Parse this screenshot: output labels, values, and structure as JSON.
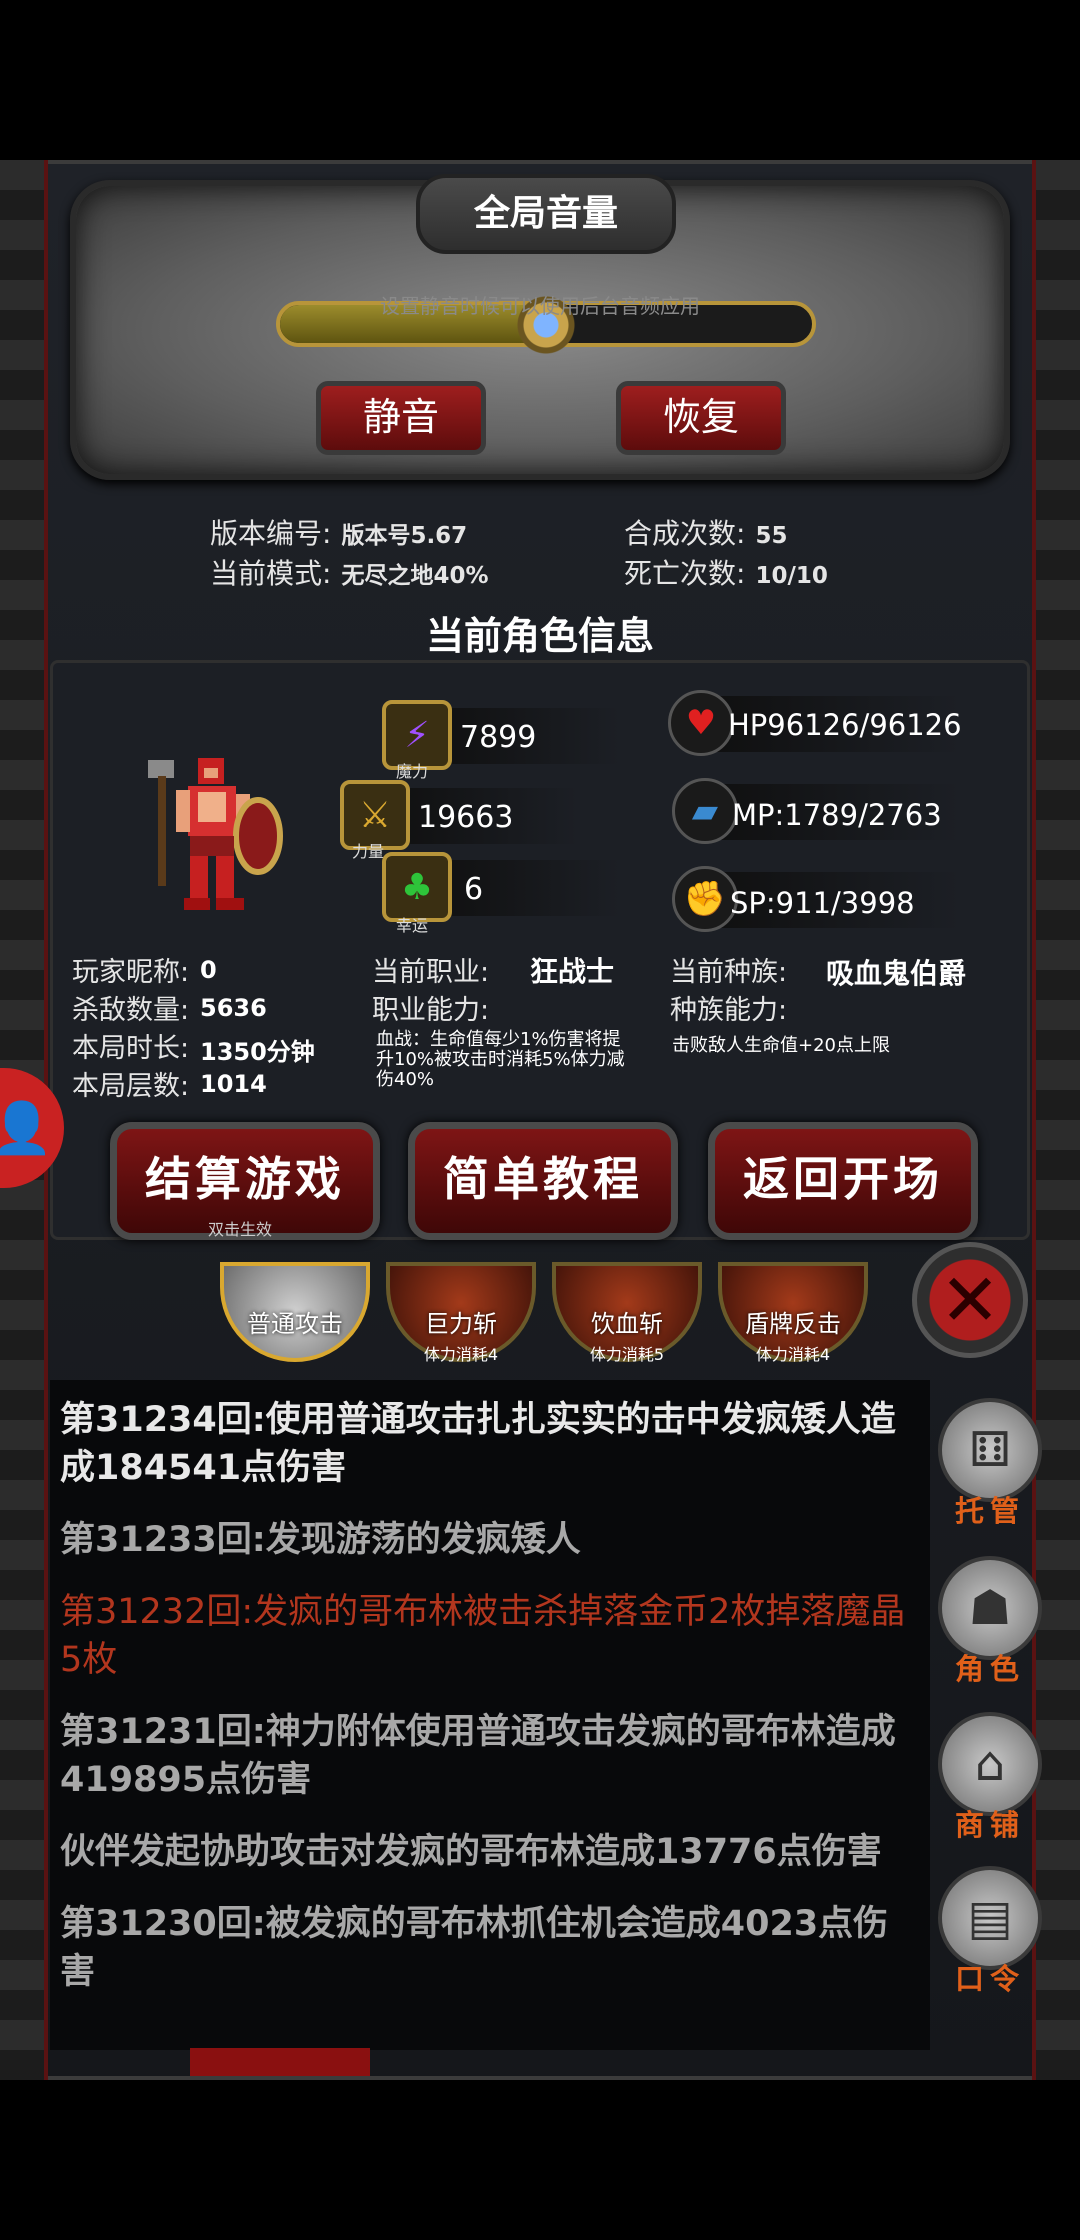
{
  "volume": {
    "title": "全局音量",
    "level": 0.5,
    "mute_label": "静音",
    "restore_label": "恢复",
    "hint": "设置静音时候可以使用后台音频应用"
  },
  "game_info": {
    "version_label": "版本编号:",
    "version_value": "版本号5.67",
    "mode_label": "当前模式:",
    "mode_value": "无尽之地40%",
    "craft_label": "合成次数:",
    "craft_value": "55",
    "death_label": "死亡次数:",
    "death_value": "10/10"
  },
  "character": {
    "section_title": "当前角色信息",
    "magic": {
      "value": "7899",
      "caption": "魔力"
    },
    "strength": {
      "value": "19663",
      "caption": "力量"
    },
    "luck": {
      "value": "6",
      "caption": "幸运"
    },
    "hp": "HP96126/96126",
    "mp": "MP:1789/2763",
    "sp": "SP:911/3998",
    "nickname_label": "玩家昵称:",
    "nickname_value": "0",
    "kills_label": "杀敌数量:",
    "kills_value": "5636",
    "duration_label": "本局时长:",
    "duration_value": "1350分钟",
    "floors_label": "本局层数:",
    "floors_value": "1014",
    "class_label": "当前职业:",
    "class_value": "狂战士",
    "class_ability_label": "职业能力:",
    "class_ability_desc": "血战：生命值每少1%伤害将提升10%被攻击时消耗5%体力减伤40%",
    "race_label": "当前种族:",
    "race_value": "吸血鬼伯爵",
    "race_ability_label": "种族能力:",
    "race_ability_desc": "击败敌人生命值+20点上限"
  },
  "actions": {
    "settle": "结算游戏",
    "settle_sub": "双击生效",
    "tutorial": "简单教程",
    "back": "返回开场"
  },
  "skills": [
    {
      "name": "普通攻击",
      "cost": ""
    },
    {
      "name": "巨力斩",
      "cost": "体力消耗4"
    },
    {
      "name": "饮血斩",
      "cost": "体力消耗5"
    },
    {
      "name": "盾牌反击",
      "cost": "体力消耗4"
    }
  ],
  "log": [
    {
      "text": "第31234回:使用普通攻击扎扎实实的击中发疯矮人造成184541点伤害"
    },
    {
      "text": "第31233回:发现游荡的发疯矮人"
    },
    {
      "text": "第31232回:发疯的哥布林被击杀掉落金币2枚掉落魔晶5枚"
    },
    {
      "text": "第31231回:神力附体使用普通攻击发疯的哥布林造成419895点伤害"
    },
    {
      "text": "伙伴发起协助攻击对发疯的哥布林造成13776点伤害"
    },
    {
      "text": "第31230回:被发疯的哥布林抓住机会造成4023点伤害"
    }
  ],
  "side_menu": {
    "auto": "托管",
    "role": "角色",
    "shop": "商铺",
    "code": "口令"
  },
  "colors": {
    "accent_red": "#9e1e1e",
    "gold": "#b8953a",
    "log_red": "#b3361e",
    "side_label": "#e0601a"
  },
  "icons": {
    "magic": "lightning-icon",
    "strength": "sword-icon",
    "luck": "clover-icon",
    "hp": "heart-icon",
    "mp": "boot-icon",
    "sp": "muscle-icon",
    "close": "close-icon",
    "auto": "dice-icon",
    "role": "hooded-figure-icon",
    "shop": "shop-icon",
    "code": "book-icon",
    "avatar": "user-icon"
  }
}
